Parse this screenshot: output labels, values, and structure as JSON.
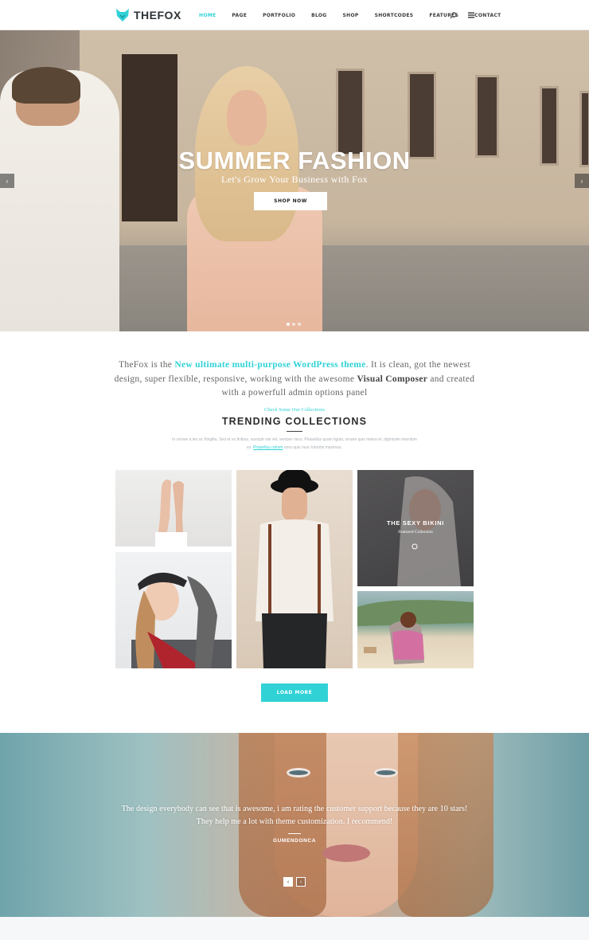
{
  "header": {
    "logo_text": "THEFOX",
    "nav": [
      {
        "label": "HOME",
        "active": true
      },
      {
        "label": "PAGE"
      },
      {
        "label": "PORTFOLIO"
      },
      {
        "label": "BLOG"
      },
      {
        "label": "SHOP"
      },
      {
        "label": "SHORTCODES"
      },
      {
        "label": "FEATURES"
      },
      {
        "label": "CONTACT"
      }
    ],
    "icons": [
      "search-icon",
      "menu-icon"
    ]
  },
  "hero": {
    "title": "SUMMER FASHION",
    "subtitle": "Let's Grow Your Business with Fox",
    "button": "SHOP NOW",
    "prev": "‹",
    "next": "›",
    "slide_count": 3,
    "active_slide": 1
  },
  "intro": {
    "part1": "TheFox is the ",
    "highlight": "New ultimate multi-purpose WordPress theme",
    "part2": ". It is clean, got the newest design, super flexible, responsive, working with the awesome ",
    "bold": "Visual Composer",
    "part3": " and created with a powerfull admin options panel"
  },
  "collections": {
    "kicker": "Check Some Our Collections",
    "title": "TRENDING COLLECTIONS",
    "desc1": "In ornare a leo ac fringilla. Sed et ex finibus, suscipit nisl vel, semper risus. Phasellus quam ligula, ornare quis metus et, dignissim interdum ex. ",
    "desc_link": "Phasellus rutrum",
    "desc2": " urna quis nunc lobortis maximus.",
    "featured_title": "THE SEXY BIKINI",
    "featured_sub": "Featured Collection",
    "load_more": "LOAD MORE"
  },
  "testimonial": {
    "quote_line1": "The design everybody can see that is awesome, i am rating the customer support because they are 10 stars!",
    "quote_line2": "They help me a lot with theme customization. I recommend!",
    "author": "GUMENDONCA",
    "prev": "‹",
    "next": "›"
  },
  "colors": {
    "accent": "#30d2d6",
    "dark": "#2d3236"
  }
}
